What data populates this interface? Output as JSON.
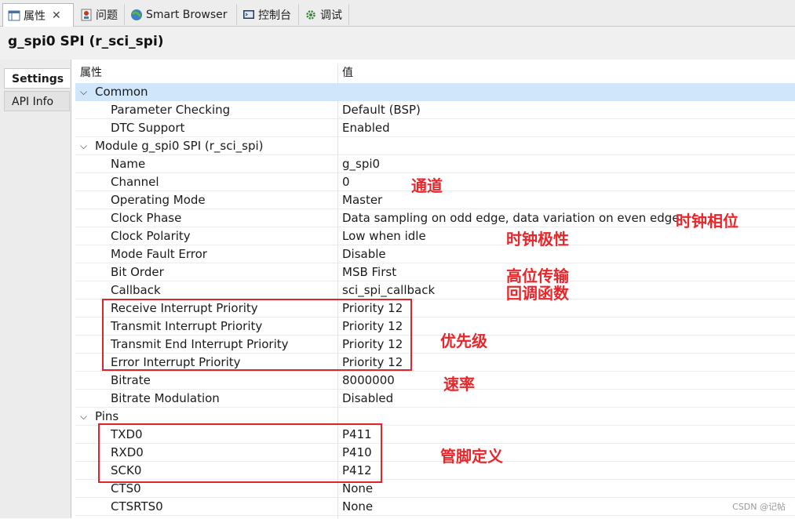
{
  "tabs": [
    {
      "label": "属性",
      "icon": "properties-icon",
      "active": true,
      "closable": true
    },
    {
      "label": "问题",
      "icon": "problems-icon"
    },
    {
      "label": "Smart Browser",
      "icon": "smart-browser-icon"
    },
    {
      "label": "控制台",
      "icon": "console-icon"
    },
    {
      "label": "调试",
      "icon": "debug-gear-icon"
    }
  ],
  "title": "g_spi0 SPI (r_sci_spi)",
  "side_tabs": [
    "Settings",
    "API Info"
  ],
  "table": {
    "col_property": "属性",
    "col_value": "值",
    "rows": [
      {
        "key": "Common",
        "value": "",
        "group": true,
        "expanded": true,
        "selected": true
      },
      {
        "key": "Parameter Checking",
        "value": "Default (BSP)"
      },
      {
        "key": "DTC Support",
        "value": "Enabled"
      },
      {
        "key": "Module g_spi0 SPI (r_sci_spi)",
        "value": "",
        "group": true,
        "expanded": true
      },
      {
        "key": "Name",
        "value": "g_spi0"
      },
      {
        "key": "Channel",
        "value": "0"
      },
      {
        "key": "Operating Mode",
        "value": "Master"
      },
      {
        "key": "Clock Phase",
        "value": "Data sampling on odd edge, data variation on even edge"
      },
      {
        "key": "Clock Polarity",
        "value": "Low when idle"
      },
      {
        "key": "Mode Fault Error",
        "value": "Disable"
      },
      {
        "key": "Bit Order",
        "value": "MSB First"
      },
      {
        "key": "Callback",
        "value": "sci_spi_callback"
      },
      {
        "key": "Receive Interrupt Priority",
        "value": "Priority 12"
      },
      {
        "key": "Transmit Interrupt Priority",
        "value": "Priority 12"
      },
      {
        "key": "Transmit End Interrupt Priority",
        "value": "Priority 12"
      },
      {
        "key": "Error Interrupt Priority",
        "value": "Priority 12"
      },
      {
        "key": "Bitrate",
        "value": "8000000"
      },
      {
        "key": "Bitrate Modulation",
        "value": "Disabled"
      },
      {
        "key": "Pins",
        "value": "",
        "group": true,
        "expanded": true
      },
      {
        "key": "TXD0",
        "value": "P411"
      },
      {
        "key": "RXD0",
        "value": "P410"
      },
      {
        "key": "SCK0",
        "value": "P412"
      },
      {
        "key": "CTS0",
        "value": "None"
      },
      {
        "key": "CTSRTS0",
        "value": "None"
      }
    ]
  },
  "annotations": {
    "channel": "通道",
    "clock_phase": "时钟相位",
    "clock_polarity": "时钟极性",
    "bit_order": "高位传输",
    "callback": "回调函数",
    "priority": "优先级",
    "bitrate": "速率",
    "pins": "管脚定义",
    "color": "#e6272b"
  },
  "watermark": "CSDN @记帖"
}
